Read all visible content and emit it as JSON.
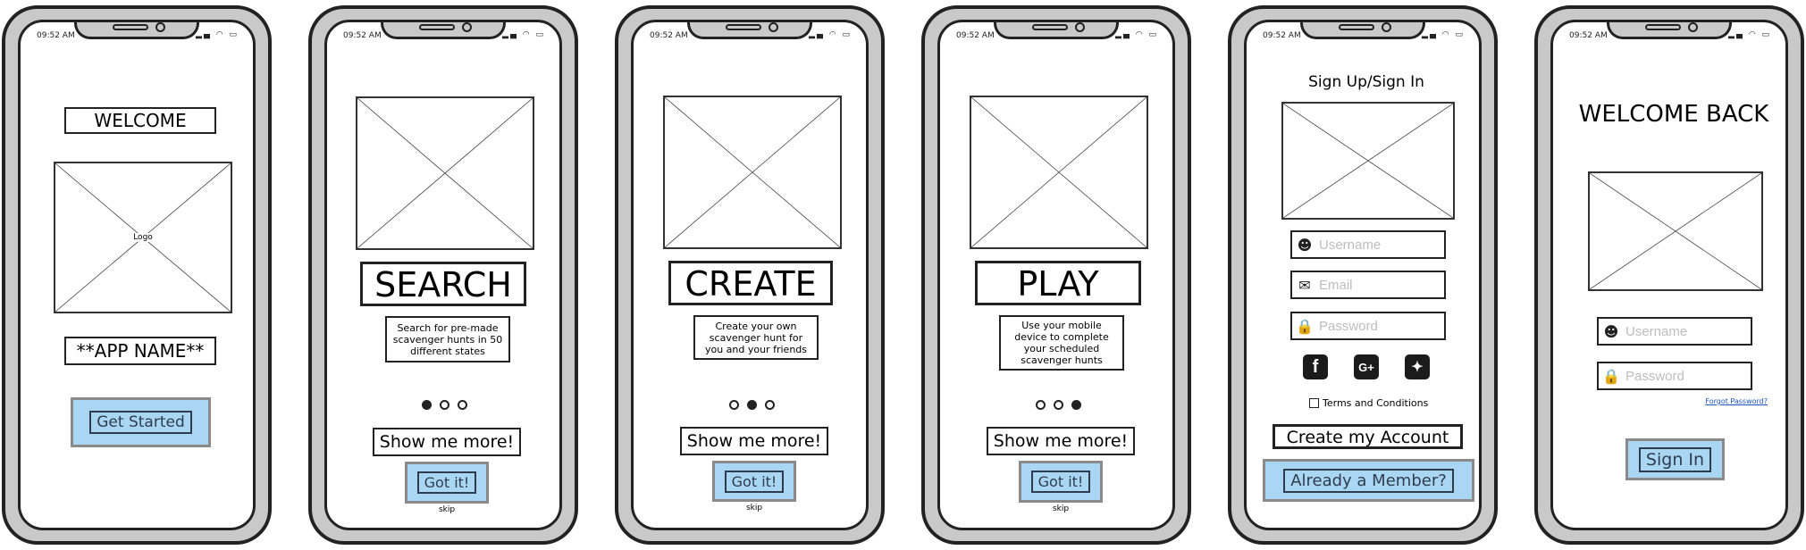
{
  "status_bar": {
    "time": "09:52 AM"
  },
  "screens": {
    "welcome": {
      "title": "WELCOME",
      "logo_label": "Logo",
      "app_name": "**APP NAME**",
      "get_started": "Get Started"
    },
    "search": {
      "title": "SEARCH",
      "description": "Search for pre-made scavenger hunts in 50 different states",
      "show_more": "Show me more!",
      "got_it": "Got it!",
      "skip": "skip"
    },
    "create": {
      "title": "CREATE",
      "description": "Create your own scavenger hunt for you and your friends",
      "show_more": "Show me more!",
      "got_it": "Got it!",
      "skip": "skip"
    },
    "play": {
      "title": "PLAY",
      "description": "Use your mobile device to complete your scheduled scavenger hunts",
      "show_more": "Show me more!",
      "got_it": "Got it!",
      "skip": "skip"
    },
    "signup": {
      "title": "Sign Up/Sign In",
      "username_placeholder": "Username",
      "email_placeholder": "Email",
      "password_placeholder": "Password",
      "terms": "Terms and Conditions",
      "create_account": "Create my Account",
      "already_member": "Already a Member?"
    },
    "signin": {
      "title": "WELCOME BACK",
      "username_placeholder": "Username",
      "password_placeholder": "Password",
      "forgot_password": "Forgot Password?",
      "sign_in": "Sign In"
    }
  },
  "colors": {
    "button_fill": "#a9d6f2",
    "phone_frame": "#c9c9c9"
  },
  "icons": [
    "wifi-icon",
    "signal-icon",
    "battery-icon",
    "user-icon",
    "envelope-icon",
    "lock-icon",
    "facebook-icon",
    "google-plus-icon",
    "twitter-icon"
  ]
}
